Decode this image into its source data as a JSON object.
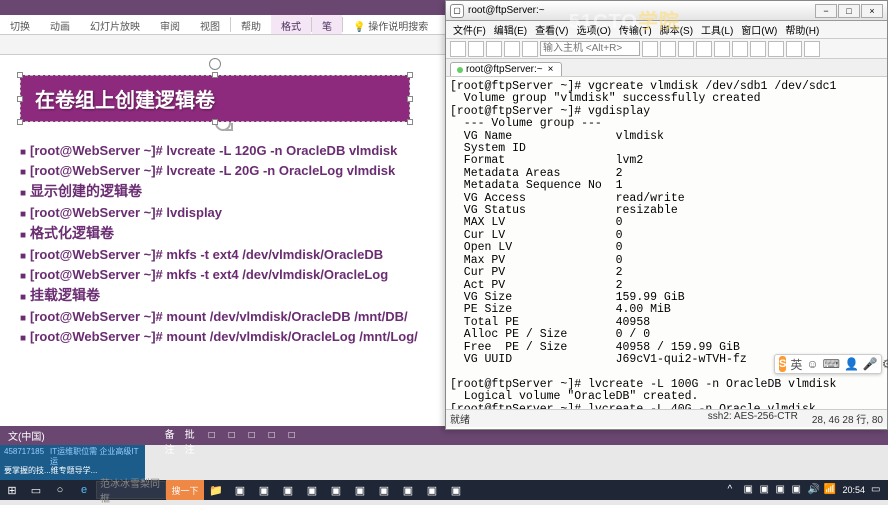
{
  "ppt": {
    "ribbon_tabs": [
      "切换",
      "动画",
      "幻灯片放映",
      "审阅",
      "视图",
      "帮助",
      "格式",
      "笔"
    ],
    "ribbon_tell": "操作说明搜索",
    "slide_title": "在卷组上创建逻辑卷",
    "bullets": [
      "[root@WebServer ~]# lvcreate -L 120G -n OracleDB vlmdisk",
      "[root@WebServer ~]# lvcreate -L 20G -n OracleLog vlmdisk",
      "显示创建的逻辑卷",
      "[root@WebServer ~]# lvdisplay",
      "格式化逻辑卷",
      "[root@WebServer ~]# mkfs -t ext4 /dev/vlmdisk/OracleDB",
      "[root@WebServer ~]# mkfs -t ext4 /dev/vlmdisk/OracleLog",
      "挂载逻辑卷",
      "[root@WebServer ~]# mount /dev/vlmdisk/OracleDB /mnt/DB/",
      "[root@WebServer ~]# mount /dev/vlmdisk/OracleLog /mnt/Log/"
    ],
    "status_left": "文(中国)",
    "status_items": [
      "≡ 备注",
      "■ 批注",
      "□",
      "□",
      "□",
      "□",
      "□"
    ]
  },
  "terminal": {
    "title": "root@ftpServer:~",
    "menu": [
      "文件(F)",
      "编辑(E)",
      "查看(V)",
      "选项(O)",
      "传输(T)",
      "脚本(S)",
      "工具(L)",
      "窗口(W)",
      "帮助(H)"
    ],
    "host_placeholder": "输入主机 <Alt+R>",
    "tab": "root@ftpServer:~",
    "output": "[root@ftpServer ~]# vgcreate vlmdisk /dev/sdb1 /dev/sdc1\n  Volume group \"vlmdisk\" successfully created\n[root@ftpServer ~]# vgdisplay\n  --- Volume group ---\n  VG Name               vlmdisk\n  System ID\n  Format                lvm2\n  Metadata Areas        2\n  Metadata Sequence No  1\n  VG Access             read/write\n  VG Status             resizable\n  MAX LV                0\n  Cur LV                0\n  Open LV               0\n  Max PV                0\n  Cur PV                2\n  Act PV                2\n  VG Size               159.99 GiB\n  PE Size               4.00 MiB\n  Total PE              40958\n  Alloc PE / Size       0 / 0\n  Free  PE / Size       40958 / 159.99 GiB\n  VG UUID               J69cV1-qui2-wTVH-fz\n\n[root@ftpServer ~]# lvcreate -L 100G -n OracleDB vlmdisk\n  Logical volume \"OracleDB\" created.\n[root@ftpServer ~]# lvcreate -L 40G -n Oracle vlmdisk",
    "status_left": "就绪",
    "status_ssh": "ssh2: AES-256-CTR",
    "status_pos": "28, 46  28 行, 80"
  },
  "watermark": {
    "a": "51CTO",
    "b": "学院"
  },
  "promo": {
    "r1a": "458717185",
    "r1b": "IT运维职位需 企业高级IT运",
    "r2": "要掌握的技...维专题导学..."
  },
  "ime": {
    "logo": "S",
    "lab": "英"
  },
  "taskbar": {
    "search": "搜一下",
    "search_label": "范冰冰雪梨同框",
    "clock": "20:54"
  }
}
